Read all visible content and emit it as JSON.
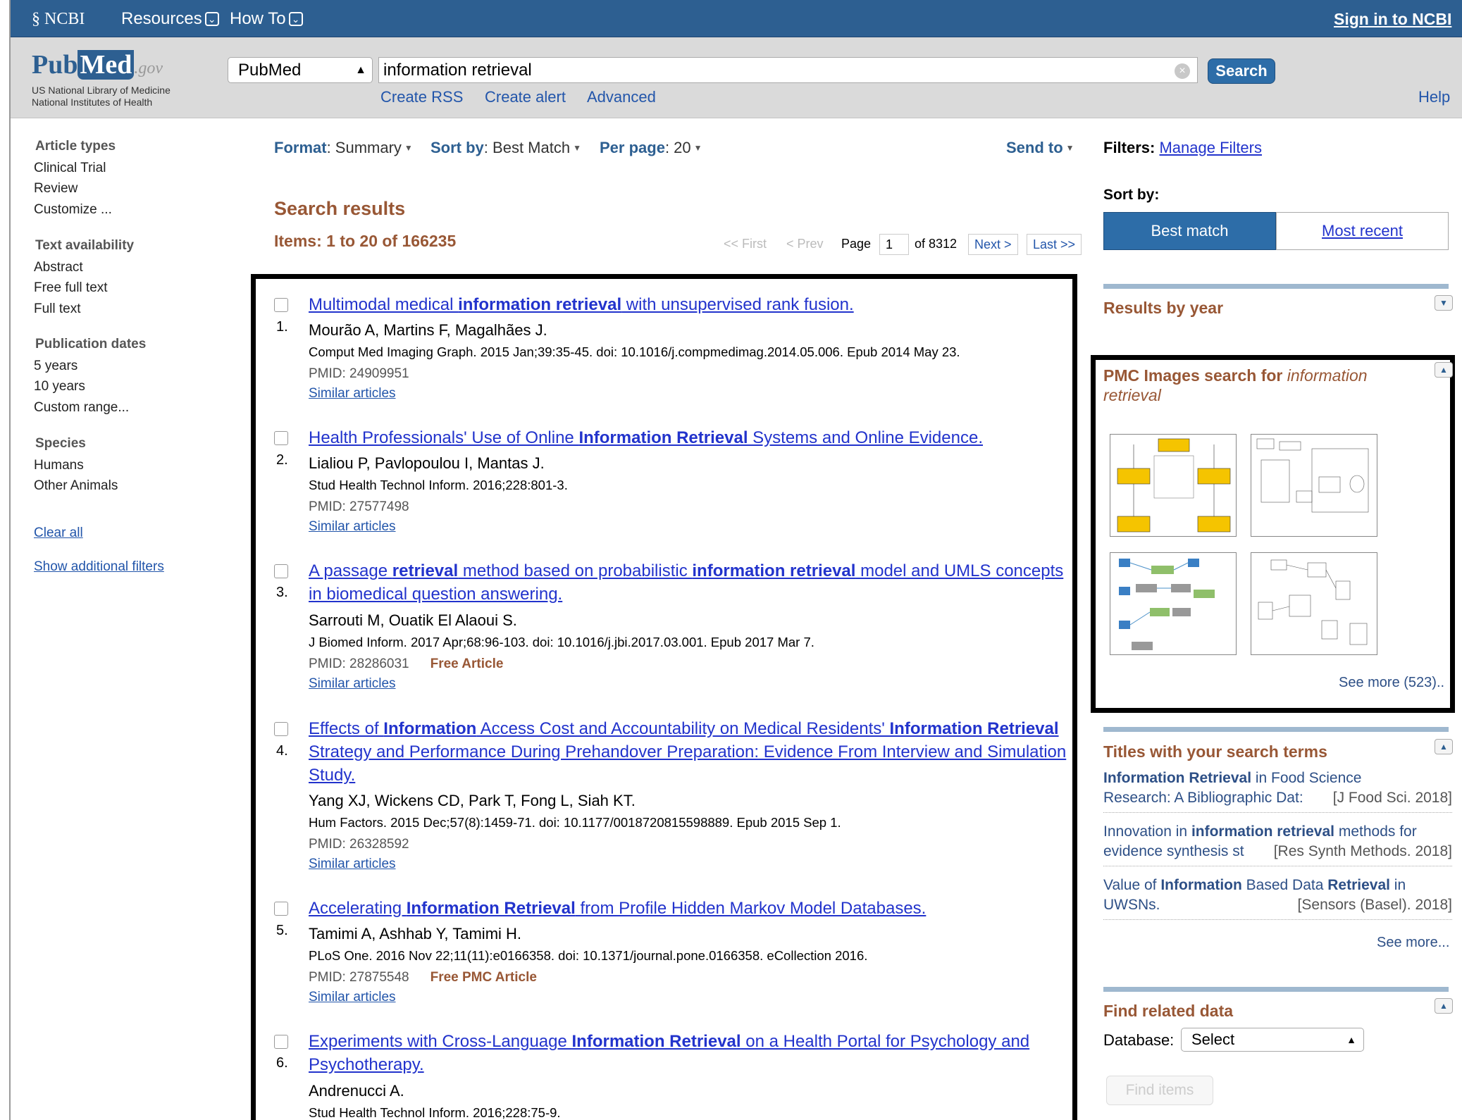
{
  "topbar": {
    "ncbi": "NCBI",
    "resources": "Resources",
    "howto": "How To",
    "signin": "Sign in to NCBI"
  },
  "header": {
    "logo_pub": "Pub",
    "logo_med": "Med",
    "logo_gov": ".gov",
    "nlm1": "US National Library of Medicine",
    "nlm2": "National Institutes of Health",
    "db": "PubMed",
    "query": "information retrieval",
    "search_label": "Search",
    "create_rss": "Create RSS",
    "create_alert": "Create alert",
    "advanced": "Advanced",
    "help": "Help"
  },
  "sidebar": {
    "article_types": {
      "head": "Article types",
      "items": [
        "Clinical Trial",
        "Review",
        "Customize ..."
      ]
    },
    "text_availability": {
      "head": "Text availability",
      "items": [
        "Abstract",
        "Free full text",
        "Full text"
      ]
    },
    "pub_dates": {
      "head": "Publication dates",
      "items": [
        "5 years",
        "10 years",
        "Custom range..."
      ]
    },
    "species": {
      "head": "Species",
      "items": [
        "Humans",
        "Other Animals"
      ]
    },
    "clear_all": "Clear all",
    "show_filters": "Show additional filters"
  },
  "controls": {
    "format_label": "Format",
    "format_value": "Summary",
    "sort_label": "Sort by",
    "sort_value": "Best Match",
    "per_page_label": "Per page",
    "per_page_value": "20",
    "send_to": "Send to"
  },
  "results_header": {
    "title": "Search results",
    "items": "Items: 1 to 20 of 166235"
  },
  "pager": {
    "first": "<< First",
    "prev": "< Prev",
    "page_label": "Page",
    "page": "1",
    "of": "of 8312",
    "next": "Next >",
    "last": "Last >>"
  },
  "results": [
    {
      "num": "1.",
      "title": "Multimodal medical information retrieval with unsupervised rank fusion.",
      "authors": "Mourão A, Martins F, Magalhães J.",
      "journal": "Comput Med Imaging Graph. 2015 Jan;39:35-45. doi: 10.1016/j.compmedimag.2014.05.006. Epub 2014 May 23.",
      "pmid": "PMID: 24909951",
      "free": "",
      "similar": "Similar articles"
    },
    {
      "num": "2.",
      "title": "Health Professionals' Use of Online Information Retrieval Systems and Online Evidence.",
      "authors": "Lialiou P, Pavlopoulou I, Mantas J.",
      "journal": "Stud Health Technol Inform. 2016;228:801-3.",
      "pmid": "PMID: 27577498",
      "free": "",
      "similar": "Similar articles"
    },
    {
      "num": "3.",
      "title": "A passage retrieval method based on probabilistic information retrieval model and UMLS concepts in biomedical question answering.",
      "authors": "Sarrouti M, Ouatik El Alaoui S.",
      "journal": "J Biomed Inform. 2017 Apr;68:96-103. doi: 10.1016/j.jbi.2017.03.001. Epub 2017 Mar 7.",
      "pmid": "PMID: 28286031",
      "free": "Free Article",
      "similar": "Similar articles"
    },
    {
      "num": "4.",
      "title": "Effects of Information Access Cost and Accountability on Medical Residents' Information Retrieval Strategy and Performance During Prehandover Preparation: Evidence From Interview and Simulation Study.",
      "authors": "Yang XJ, Wickens CD, Park T, Fong L, Siah KT.",
      "journal": "Hum Factors. 2015 Dec;57(8):1459-71. doi: 10.1177/0018720815598889. Epub 2015 Sep 1.",
      "pmid": "PMID: 26328592",
      "free": "",
      "similar": "Similar articles"
    },
    {
      "num": "5.",
      "title": "Accelerating Information Retrieval from Profile Hidden Markov Model Databases.",
      "authors": "Tamimi A, Ashhab Y, Tamimi H.",
      "journal": "PLoS One. 2016 Nov 22;11(11):e0166358. doi: 10.1371/journal.pone.0166358. eCollection 2016.",
      "pmid": "PMID: 27875548",
      "free": "Free PMC Article",
      "similar": "Similar articles"
    },
    {
      "num": "6.",
      "title": "Experiments with Cross-Language Information Retrieval on a Health Portal for Psychology and Psychotherapy.",
      "authors": "Andrenucci A.",
      "journal": "Stud Health Technol Inform. 2016;228:75-9.",
      "pmid": "",
      "free": "",
      "similar": ""
    }
  ],
  "right": {
    "filters_label": "Filters:",
    "manage_filters": "Manage Filters",
    "sort_by": "Sort by:",
    "best_match": "Best match",
    "most_recent": "Most recent",
    "results_by_year": "Results by year",
    "pmc_head": "PMC Images search for ",
    "pmc_query1": "information",
    "pmc_query2": "retrieval",
    "see_more_images": "See more (523)..",
    "titles_head": "Titles with your search terms",
    "titles": [
      {
        "a": "Information Retrieval",
        "b": " in Food Science",
        "c": "Research: A Bibliographic Dat:",
        "j": "[J Food Sci. 2018]"
      },
      {
        "a": "Innovation in ",
        "b": "information retrieval",
        "c": " methods for",
        "d": "evidence synthesis st",
        "j": "[Res Synth Methods. 2018]"
      },
      {
        "a": "Value of ",
        "b": "Information",
        "c": " Based Data ",
        "d": "Retrieval",
        "e": " in",
        "f": "UWSNs.",
        "j": "[Sensors (Basel). 2018]"
      }
    ],
    "see_more": "See more...",
    "related_head": "Find related data",
    "database_label": "Database:",
    "database_value": "Select",
    "find_items": "Find items"
  },
  "colors": {
    "ncbi_blue": "#2d5f91",
    "result_link": "#2233cc",
    "heading_brown": "#985735",
    "thumb_yellow": "#f5c400"
  }
}
